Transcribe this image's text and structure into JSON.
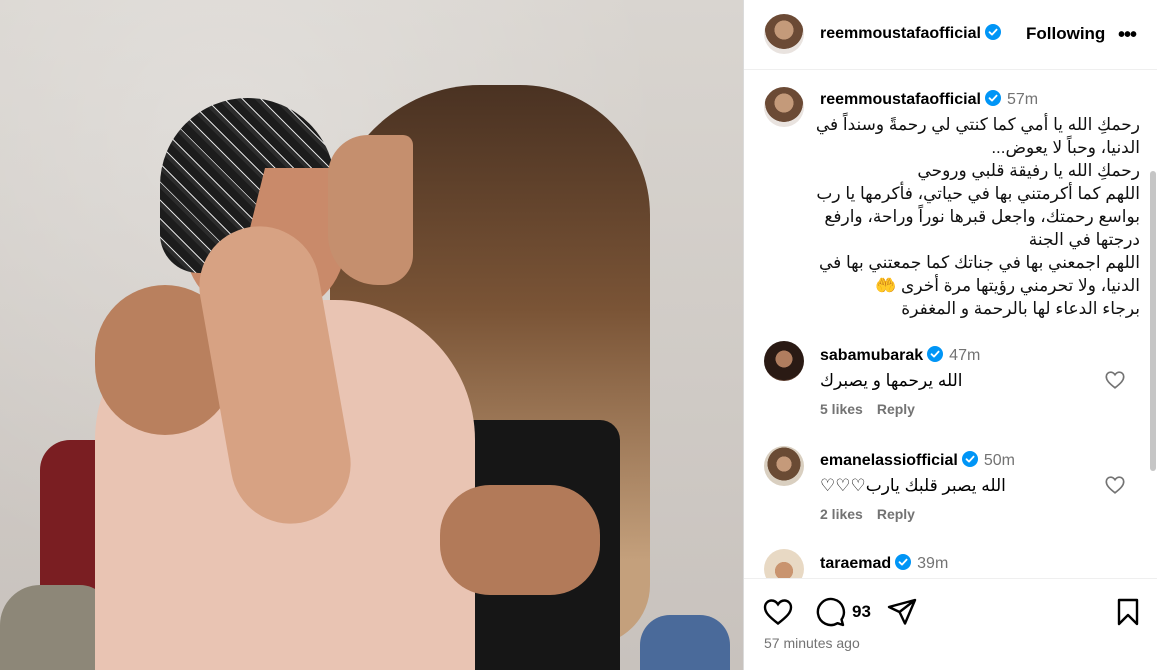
{
  "post": {
    "author": "reemmoustafaofficial",
    "follow_label": "Following",
    "more_label": "•••"
  },
  "caption": {
    "user": "reemmoustafaofficial",
    "time": "57m",
    "text": "رحمكِ الله يا أمي كما كنتي لي رحمةً وسنداً في الدنيا، وحباً لا يعوض...\nرحمكِ الله يا رفيقة قلبي وروحي\nاللهم كما أكرمتني بها في حياتي، فأكرمها يا رب بواسع رحمتك، واجعل قبرها نوراً وراحة، وارفع درجتها في الجنة\nاللهم اجمعني بها في جناتك كما جمعتني بها في الدنيا، ولا تحرمني رؤيتها مرة أخرى 🤲\nبرجاء الدعاء لها بالرحمة و المغفرة"
  },
  "comments": [
    {
      "user": "sabamubarak",
      "time": "47m",
      "text": "الله يرحمها و يصبرك",
      "likes": "5 likes",
      "reply": "Reply"
    },
    {
      "user": "emanelassiofficial",
      "time": "50m",
      "text": "الله يصبر قلبك يارب♡♡♡",
      "likes": "2 likes",
      "reply": "Reply"
    },
    {
      "user": "taraemad",
      "time": "39m"
    }
  ],
  "actions": {
    "comment_count": "93",
    "timestamp": "57 minutes ago"
  },
  "icons": {
    "verified": "verified-badge-icon",
    "like": "heart-icon",
    "comment": "comment-icon",
    "share": "share-icon",
    "save": "bookmark-icon"
  },
  "colors": {
    "verified": "#0095f6",
    "muted": "#737373",
    "border": "#dbdbdb"
  }
}
